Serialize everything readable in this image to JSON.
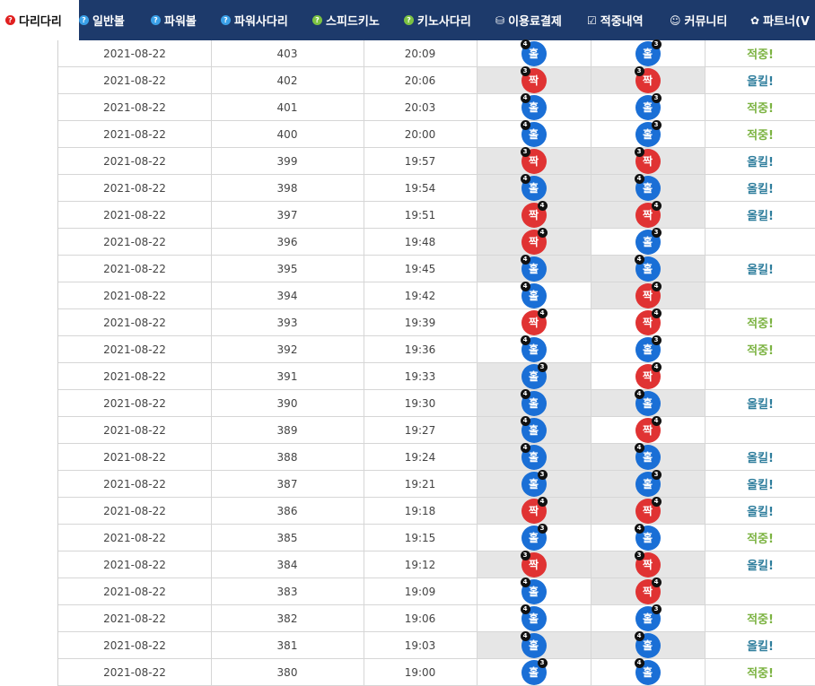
{
  "nav": {
    "tabs": [
      {
        "label": "다리다리",
        "icon": "question-circle-icon",
        "icon_glyph": "?",
        "icon_color": "#e02020",
        "active": true
      },
      {
        "label": "일반볼",
        "icon": "question-circle-icon",
        "icon_glyph": "?",
        "icon_color": "#3aa0e8"
      },
      {
        "label": "파워볼",
        "icon": "question-circle-icon",
        "icon_glyph": "?",
        "icon_color": "#3aa0e8"
      },
      {
        "label": "파워사다리",
        "icon": "question-circle-icon",
        "icon_glyph": "?",
        "icon_color": "#3aa0e8"
      },
      {
        "label": "스피드키노",
        "icon": "question-circle-icon",
        "icon_glyph": "?",
        "icon_color": "#7cc242"
      },
      {
        "label": "키노사다리",
        "icon": "question-circle-icon",
        "icon_glyph": "?",
        "icon_color": "#7cc242"
      },
      {
        "label": "이용료결제",
        "icon": "coins-icon",
        "icon_glyph": "⛁",
        "icon_color": "#ffffff"
      },
      {
        "label": "적중내역",
        "icon": "checkbox-icon",
        "icon_glyph": "☑",
        "icon_color": "#ffffff"
      },
      {
        "label": "커뮤니티",
        "icon": "smile-icon",
        "icon_glyph": "☺",
        "icon_color": "#ffffff"
      },
      {
        "label": "파트너(V",
        "icon": "cubes-icon",
        "icon_glyph": "✿",
        "icon_color": "#ffffff"
      }
    ]
  },
  "colors": {
    "hit": "#7cb342",
    "kill": "#2e7d9c",
    "odd": "#1a6fd6",
    "even": "#e03333",
    "nav": "#1d3a6b"
  },
  "rows": [
    {
      "date": "2021-08-22",
      "round": "403",
      "time": "20:09",
      "a": {
        "label": "홀",
        "type": "odd",
        "n": "4",
        "pos": "l"
      },
      "b": {
        "label": "홀",
        "type": "odd",
        "n": "3",
        "pos": "r"
      },
      "result": "적중!",
      "result_type": "hit",
      "shade_a": false,
      "shade_b": false
    },
    {
      "date": "2021-08-22",
      "round": "402",
      "time": "20:06",
      "a": {
        "label": "짝",
        "type": "even",
        "n": "3",
        "pos": "l"
      },
      "b": {
        "label": "짝",
        "type": "even",
        "n": "3",
        "pos": "l"
      },
      "result": "올킬!",
      "result_type": "kill",
      "shade_a": true,
      "shade_b": true
    },
    {
      "date": "2021-08-22",
      "round": "401",
      "time": "20:03",
      "a": {
        "label": "홀",
        "type": "odd",
        "n": "4",
        "pos": "l"
      },
      "b": {
        "label": "홀",
        "type": "odd",
        "n": "3",
        "pos": "r"
      },
      "result": "적중!",
      "result_type": "hit",
      "shade_a": false,
      "shade_b": false
    },
    {
      "date": "2021-08-22",
      "round": "400",
      "time": "20:00",
      "a": {
        "label": "홀",
        "type": "odd",
        "n": "4",
        "pos": "l"
      },
      "b": {
        "label": "홀",
        "type": "odd",
        "n": "3",
        "pos": "r"
      },
      "result": "적중!",
      "result_type": "hit",
      "shade_a": false,
      "shade_b": false
    },
    {
      "date": "2021-08-22",
      "round": "399",
      "time": "19:57",
      "a": {
        "label": "짝",
        "type": "even",
        "n": "3",
        "pos": "l"
      },
      "b": {
        "label": "짝",
        "type": "even",
        "n": "3",
        "pos": "l"
      },
      "result": "올킬!",
      "result_type": "kill",
      "shade_a": true,
      "shade_b": true
    },
    {
      "date": "2021-08-22",
      "round": "398",
      "time": "19:54",
      "a": {
        "label": "홀",
        "type": "odd",
        "n": "4",
        "pos": "l"
      },
      "b": {
        "label": "홀",
        "type": "odd",
        "n": "4",
        "pos": "l"
      },
      "result": "올킬!",
      "result_type": "kill",
      "shade_a": true,
      "shade_b": true
    },
    {
      "date": "2021-08-22",
      "round": "397",
      "time": "19:51",
      "a": {
        "label": "짝",
        "type": "even",
        "n": "4",
        "pos": "r"
      },
      "b": {
        "label": "짝",
        "type": "even",
        "n": "4",
        "pos": "r"
      },
      "result": "올킬!",
      "result_type": "kill",
      "shade_a": true,
      "shade_b": true
    },
    {
      "date": "2021-08-22",
      "round": "396",
      "time": "19:48",
      "a": {
        "label": "짝",
        "type": "even",
        "n": "4",
        "pos": "r"
      },
      "b": {
        "label": "홀",
        "type": "odd",
        "n": "3",
        "pos": "r"
      },
      "result": "",
      "result_type": "",
      "shade_a": true,
      "shade_b": false
    },
    {
      "date": "2021-08-22",
      "round": "395",
      "time": "19:45",
      "a": {
        "label": "홀",
        "type": "odd",
        "n": "4",
        "pos": "l"
      },
      "b": {
        "label": "홀",
        "type": "odd",
        "n": "4",
        "pos": "l"
      },
      "result": "올킬!",
      "result_type": "kill",
      "shade_a": true,
      "shade_b": true
    },
    {
      "date": "2021-08-22",
      "round": "394",
      "time": "19:42",
      "a": {
        "label": "홀",
        "type": "odd",
        "n": "4",
        "pos": "l"
      },
      "b": {
        "label": "짝",
        "type": "even",
        "n": "4",
        "pos": "r"
      },
      "result": "",
      "result_type": "",
      "shade_a": false,
      "shade_b": true
    },
    {
      "date": "2021-08-22",
      "round": "393",
      "time": "19:39",
      "a": {
        "label": "짝",
        "type": "even",
        "n": "4",
        "pos": "r"
      },
      "b": {
        "label": "짝",
        "type": "even",
        "n": "4",
        "pos": "r"
      },
      "result": "적중!",
      "result_type": "hit",
      "shade_a": false,
      "shade_b": false
    },
    {
      "date": "2021-08-22",
      "round": "392",
      "time": "19:36",
      "a": {
        "label": "홀",
        "type": "odd",
        "n": "4",
        "pos": "l"
      },
      "b": {
        "label": "홀",
        "type": "odd",
        "n": "3",
        "pos": "r"
      },
      "result": "적중!",
      "result_type": "hit",
      "shade_a": false,
      "shade_b": false
    },
    {
      "date": "2021-08-22",
      "round": "391",
      "time": "19:33",
      "a": {
        "label": "홀",
        "type": "odd",
        "n": "3",
        "pos": "r"
      },
      "b": {
        "label": "짝",
        "type": "even",
        "n": "4",
        "pos": "r"
      },
      "result": "",
      "result_type": "",
      "shade_a": true,
      "shade_b": false
    },
    {
      "date": "2021-08-22",
      "round": "390",
      "time": "19:30",
      "a": {
        "label": "홀",
        "type": "odd",
        "n": "4",
        "pos": "l"
      },
      "b": {
        "label": "홀",
        "type": "odd",
        "n": "4",
        "pos": "l"
      },
      "result": "올킬!",
      "result_type": "kill",
      "shade_a": true,
      "shade_b": true
    },
    {
      "date": "2021-08-22",
      "round": "389",
      "time": "19:27",
      "a": {
        "label": "홀",
        "type": "odd",
        "n": "4",
        "pos": "l"
      },
      "b": {
        "label": "짝",
        "type": "even",
        "n": "4",
        "pos": "r"
      },
      "result": "",
      "result_type": "",
      "shade_a": true,
      "shade_b": false
    },
    {
      "date": "2021-08-22",
      "round": "388",
      "time": "19:24",
      "a": {
        "label": "홀",
        "type": "odd",
        "n": "4",
        "pos": "l"
      },
      "b": {
        "label": "홀",
        "type": "odd",
        "n": "4",
        "pos": "l"
      },
      "result": "올킬!",
      "result_type": "kill",
      "shade_a": true,
      "shade_b": true
    },
    {
      "date": "2021-08-22",
      "round": "387",
      "time": "19:21",
      "a": {
        "label": "홀",
        "type": "odd",
        "n": "3",
        "pos": "r"
      },
      "b": {
        "label": "홀",
        "type": "odd",
        "n": "3",
        "pos": "r"
      },
      "result": "올킬!",
      "result_type": "kill",
      "shade_a": true,
      "shade_b": true
    },
    {
      "date": "2021-08-22",
      "round": "386",
      "time": "19:18",
      "a": {
        "label": "짝",
        "type": "even",
        "n": "4",
        "pos": "r"
      },
      "b": {
        "label": "짝",
        "type": "even",
        "n": "4",
        "pos": "r"
      },
      "result": "올킬!",
      "result_type": "kill",
      "shade_a": true,
      "shade_b": true
    },
    {
      "date": "2021-08-22",
      "round": "385",
      "time": "19:15",
      "a": {
        "label": "홀",
        "type": "odd",
        "n": "3",
        "pos": "r"
      },
      "b": {
        "label": "홀",
        "type": "odd",
        "n": "4",
        "pos": "l"
      },
      "result": "적중!",
      "result_type": "hit",
      "shade_a": false,
      "shade_b": false
    },
    {
      "date": "2021-08-22",
      "round": "384",
      "time": "19:12",
      "a": {
        "label": "짝",
        "type": "even",
        "n": "3",
        "pos": "l"
      },
      "b": {
        "label": "짝",
        "type": "even",
        "n": "3",
        "pos": "l"
      },
      "result": "올킬!",
      "result_type": "kill",
      "shade_a": true,
      "shade_b": true
    },
    {
      "date": "2021-08-22",
      "round": "383",
      "time": "19:09",
      "a": {
        "label": "홀",
        "type": "odd",
        "n": "4",
        "pos": "l"
      },
      "b": {
        "label": "짝",
        "type": "even",
        "n": "4",
        "pos": "r"
      },
      "result": "",
      "result_type": "",
      "shade_a": false,
      "shade_b": true
    },
    {
      "date": "2021-08-22",
      "round": "382",
      "time": "19:06",
      "a": {
        "label": "홀",
        "type": "odd",
        "n": "4",
        "pos": "l"
      },
      "b": {
        "label": "홀",
        "type": "odd",
        "n": "3",
        "pos": "r"
      },
      "result": "적중!",
      "result_type": "hit",
      "shade_a": false,
      "shade_b": false
    },
    {
      "date": "2021-08-22",
      "round": "381",
      "time": "19:03",
      "a": {
        "label": "홀",
        "type": "odd",
        "n": "4",
        "pos": "l"
      },
      "b": {
        "label": "홀",
        "type": "odd",
        "n": "4",
        "pos": "l"
      },
      "result": "올킬!",
      "result_type": "kill",
      "shade_a": true,
      "shade_b": true
    },
    {
      "date": "2021-08-22",
      "round": "380",
      "time": "19:00",
      "a": {
        "label": "홀",
        "type": "odd",
        "n": "3",
        "pos": "r"
      },
      "b": {
        "label": "홀",
        "type": "odd",
        "n": "4",
        "pos": "l"
      },
      "result": "적중!",
      "result_type": "hit",
      "shade_a": false,
      "shade_b": false
    }
  ]
}
